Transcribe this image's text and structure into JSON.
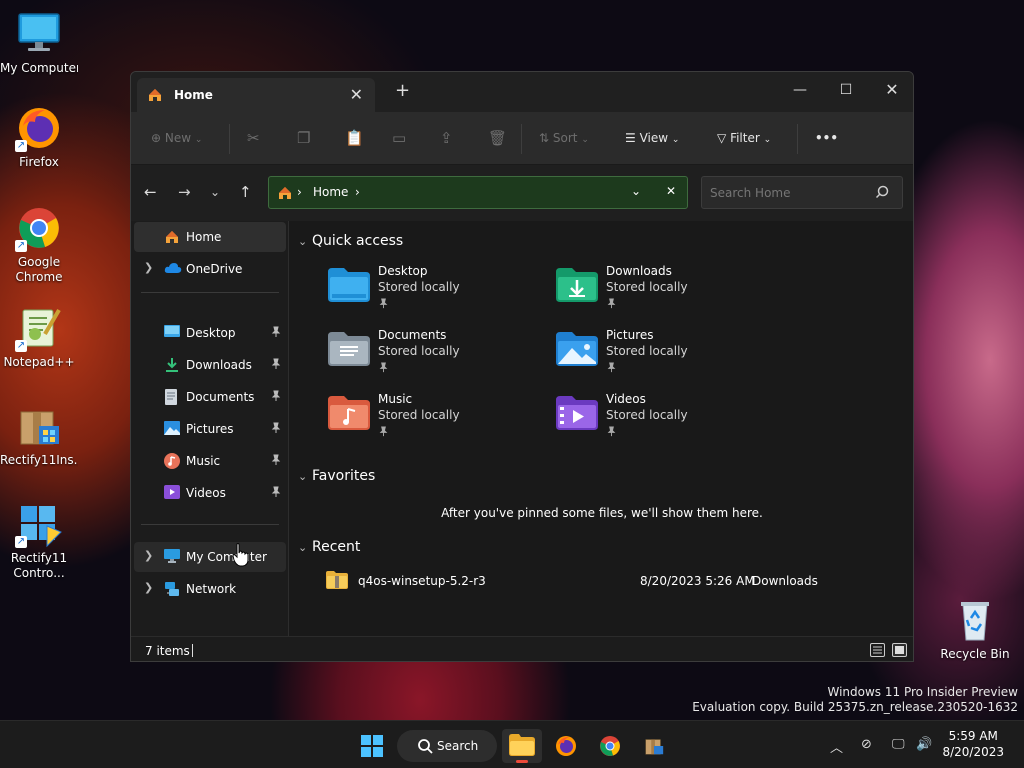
{
  "desktop": {
    "icons": [
      {
        "label": "My Computer",
        "icon": "monitor-icon"
      },
      {
        "label": "Firefox",
        "icon": "firefox-icon"
      },
      {
        "label": "Google Chrome",
        "icon": "chrome-icon"
      },
      {
        "label": "Notepad++",
        "icon": "notepadpp-icon"
      },
      {
        "label": "Rectify11Ins...",
        "icon": "installer-box-icon"
      },
      {
        "label": "Rectify11 Contro...",
        "icon": "rectify-control-icon"
      },
      {
        "label": "Recycle Bin",
        "icon": "recycle-bin-icon"
      }
    ]
  },
  "window": {
    "tab_title": "Home",
    "toolbar": {
      "new_label": "New",
      "sort_label": "Sort",
      "view_label": "View",
      "filter_label": "Filter",
      "more_label": "•••"
    },
    "address": {
      "crumb": "Home"
    },
    "search": {
      "placeholder": "Search Home"
    },
    "nav": {
      "home": "Home",
      "onedrive": "OneDrive",
      "pinned": [
        "Desktop",
        "Downloads",
        "Documents",
        "Pictures",
        "Music",
        "Videos"
      ],
      "my_computer": "My Computer",
      "network": "Network"
    },
    "content": {
      "quick_access_title": "Quick access",
      "quick_access": [
        {
          "name": "Desktop",
          "sub": "Stored locally"
        },
        {
          "name": "Downloads",
          "sub": "Stored locally"
        },
        {
          "name": "Documents",
          "sub": "Stored locally"
        },
        {
          "name": "Pictures",
          "sub": "Stored locally"
        },
        {
          "name": "Music",
          "sub": "Stored locally"
        },
        {
          "name": "Videos",
          "sub": "Stored locally"
        }
      ],
      "favorites_title": "Favorites",
      "favorites_empty": "After you've pinned some files, we'll show them here.",
      "recent_title": "Recent",
      "recent": [
        {
          "name": "q4os-winsetup-5.2-r3",
          "date": "8/20/2023 5:26 AM",
          "location": "Downloads"
        }
      ]
    },
    "status": {
      "item_count": "7 items"
    }
  },
  "watermark": {
    "line1": "Windows 11 Pro Insider Preview",
    "line2": "Evaluation copy. Build 25375.zn_release.230520-1632"
  },
  "taskbar": {
    "search_label": "Search",
    "time": "5:59 AM",
    "date": "8/20/2023"
  },
  "colors": {
    "accent": "#0078d4",
    "address_bg": "#1d3a1d",
    "taskbar_indicator": "#ec4a3a"
  }
}
